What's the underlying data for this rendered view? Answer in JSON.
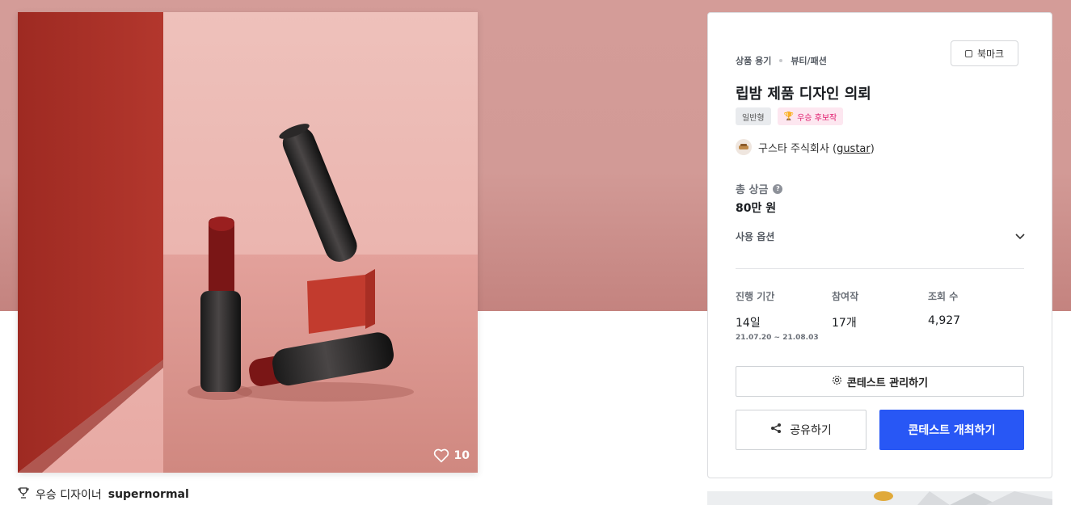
{
  "product": {
    "like_count": "10",
    "winner_prefix": "우승 디자이너",
    "winner_name": "supernormal"
  },
  "contest": {
    "category_main": "상품 용기",
    "category_sub": "뷰티/패션",
    "bookmark_label": "북마크",
    "title": "립밤 제품 디자인 의뢰",
    "badge_type": "일반형",
    "badge_award": "우승 후보작",
    "host_name": "구스타 주식회사 (",
    "host_id": "gustar",
    "host_suffix": ")",
    "prize_label": "총 상금",
    "prize_value": "80만 원",
    "usage_label": "사용 옵션",
    "stats": {
      "period_label": "진행 기간",
      "period_value": "14일",
      "period_range": "21.07.20 ~ 21.08.03",
      "entries_label": "참여작",
      "entries_value": "17개",
      "views_label": "조회 수",
      "views_value": "4,927"
    },
    "manage_label": "콘테스트 관리하기",
    "share_label": "공유하기",
    "host_contest_label": "콘테스트 개최하기"
  },
  "colors": {
    "primary": "#2857f5",
    "award_pink": "#e0176a",
    "hero_bg": "#d49c98"
  }
}
